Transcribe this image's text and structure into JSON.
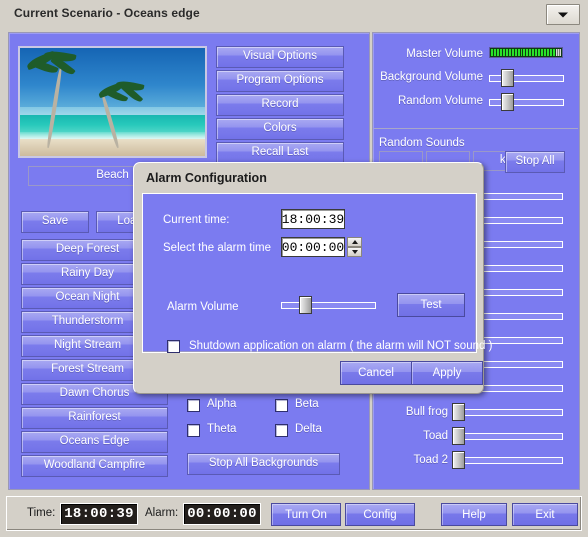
{
  "window": {
    "title": "Current Scenario - Oceans edge",
    "combo_icon": "chevron-down-icon"
  },
  "preview": {
    "scene_alt": "tropical beach with palm trees",
    "caption": "Beach"
  },
  "scenario_buttons": [
    {
      "label": "Save"
    },
    {
      "label": "Load"
    },
    {
      "label": "Deep Forest"
    },
    {
      "label": "Rainy Day"
    },
    {
      "label": "Ocean Night"
    },
    {
      "label": "Thunderstorm"
    },
    {
      "label": "Night Stream"
    },
    {
      "label": "Forest Stream"
    },
    {
      "label": "Dawn Chorus"
    },
    {
      "label": "Rainforest"
    },
    {
      "label": "Oceans Edge"
    },
    {
      "label": "Woodland Campfire"
    }
  ],
  "options_buttons": [
    {
      "label": "Visual Options"
    },
    {
      "label": "Program Options"
    },
    {
      "label": "Record"
    },
    {
      "label": "Colors"
    },
    {
      "label": "Recall Last"
    }
  ],
  "wave_checkboxes": [
    {
      "label": "Alpha",
      "checked": false
    },
    {
      "label": "Beta",
      "checked": false
    },
    {
      "label": "Theta",
      "checked": false
    },
    {
      "label": "Delta",
      "checked": false
    }
  ],
  "stop_backgrounds_label": "Stop All Backgrounds",
  "volumes": {
    "master_label": "Master Volume",
    "master_segments": 22,
    "background_label": "Background Volume",
    "background_value": 12,
    "random_label": "Random Volume",
    "random_value": 12
  },
  "random_sounds": {
    "heading": "Random Sounds",
    "partial_button_label": "k3",
    "stop_all_label": "Stop All"
  },
  "sound_sliders": [
    {
      "label": "Bull frog",
      "value": 4
    },
    {
      "label": "Toad",
      "value": 4
    },
    {
      "label": "Toad 2",
      "value": 4
    }
  ],
  "dialog": {
    "title": "Alarm Configuration",
    "current_time_label": "Current time:",
    "current_time_value": "18:00:39",
    "alarm_time_label": "Select the alarm time",
    "alarm_time_value": "00:00:00",
    "alarm_volume_label": "Alarm Volume",
    "alarm_volume_value": 18,
    "test_label": "Test",
    "shutdown_label": "Shutdown application on alarm ( the alarm will NOT sound )",
    "shutdown_checked": false,
    "cancel_label": "Cancel",
    "apply_label": "Apply"
  },
  "statusbar": {
    "time_label": "Time:",
    "time_value": "18:00:39",
    "alarm_label": "Alarm:",
    "alarm_value": "00:00:00",
    "turn_on_label": "Turn On",
    "config_label": "Config",
    "help_label": "Help",
    "exit_label": "Exit"
  },
  "colors": {
    "panel_purple": "#7b7bf0",
    "chrome_gray": "#d4d0c8",
    "led_green": "#2ae22a",
    "lcd_bg": "#231f1c"
  }
}
